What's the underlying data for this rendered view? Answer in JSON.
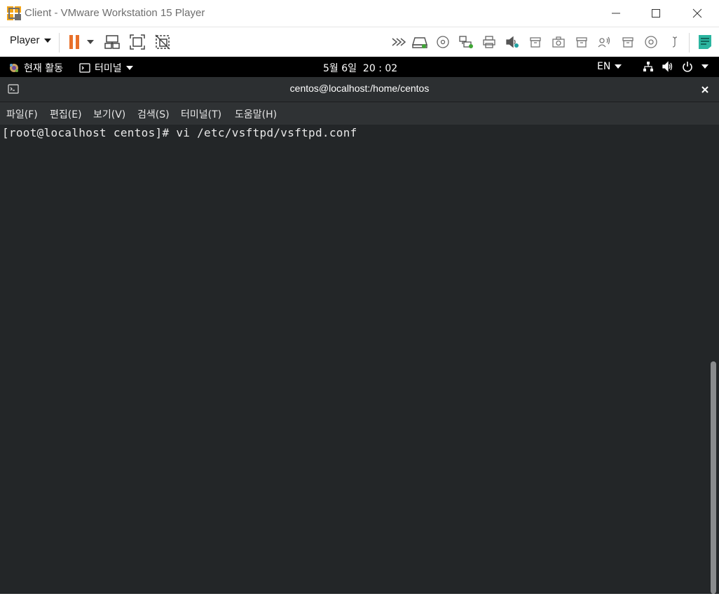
{
  "window": {
    "title": "Client - VMware Workstation 15 Player",
    "controls": [
      "minimize-icon",
      "maximize-icon",
      "close-icon"
    ]
  },
  "toolbar": {
    "player_label": "Player",
    "icons": [
      "pause-icon",
      "dropdown-arrow-icon",
      "send-ctrl-alt-del-icon",
      "full-screen-icon",
      "unity-icon"
    ],
    "devices": [
      "more-devices-icon",
      "hard-disk-icon",
      "cd-dvd-icon",
      "network-adapter-icon",
      "printer-icon",
      "sound-card-icon",
      "usb-device-icon",
      "camera-icon",
      "usb-device-icon",
      "bluetooth-icon",
      "usb-device-icon",
      "cd-icon",
      "settings-icon"
    ],
    "notes_icon": "message-log-icon",
    "accent": "#e8702a"
  },
  "gnome": {
    "activities": "현재 활동",
    "app_menu": "터미널",
    "clock": "5월 6일  20 : 02",
    "lang": "EN"
  },
  "terminal": {
    "title": "centos@localhost:/home/centos",
    "menus": [
      "파일(F)",
      "편집(E)",
      "보기(V)",
      "검색(S)",
      "터미널(T)",
      "도움말(H)"
    ],
    "prompt_line": "[root@localhost centos]# vi /etc/vsftpd/vsftpd.conf",
    "background": "#232628"
  }
}
